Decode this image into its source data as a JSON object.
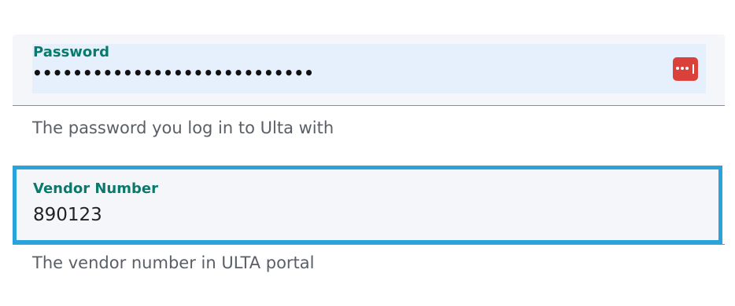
{
  "top_cut_text": "",
  "password": {
    "label": "Password",
    "value_masked": "••••••••••••••••••••••••••••",
    "helper": "The password you log in to Ulta with",
    "manager_icon": "password-manager-icon",
    "manager_color": "#d9413a"
  },
  "vendor": {
    "label": "Vendor Number",
    "value": "890123",
    "helper": "The vendor number in ULTA portal",
    "highlight_color": "#2aa3dc"
  },
  "colors": {
    "label_color": "#0a7a6c",
    "field_bg": "#f4f6fa",
    "autofill_bg": "#e6effc",
    "helper_text": "#5a5f66"
  }
}
